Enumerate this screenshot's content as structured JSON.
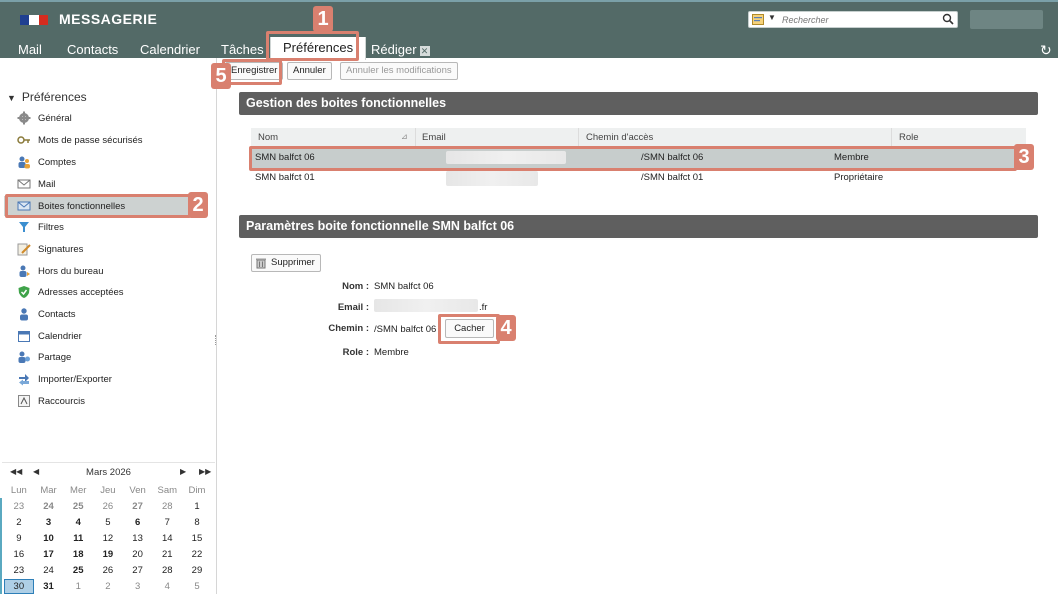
{
  "header": {
    "brand": "MESSAGERIE",
    "search_placeholder": "Rechercher",
    "flag_colors": [
      "#1f3f91",
      "#ffffff",
      "#d52b1e"
    ],
    "theme_color": "#536a67"
  },
  "tabs": [
    {
      "label": "Mail"
    },
    {
      "label": "Contacts"
    },
    {
      "label": "Calendrier"
    },
    {
      "label": "Tâches"
    },
    {
      "label": "Préférences",
      "active": true
    },
    {
      "label": "Rédiger",
      "closable": true
    }
  ],
  "toolbar": {
    "save": "Enregistrer",
    "cancel": "Annuler",
    "undo": "Annuler les modifications"
  },
  "sidebar": {
    "title": "Préférences",
    "items": [
      {
        "label": "Général",
        "icon": "gear-icon"
      },
      {
        "label": "Mots de passe sécurisés",
        "icon": "key-icon"
      },
      {
        "label": "Comptes",
        "icon": "users-icon"
      },
      {
        "label": "Mail",
        "icon": "envelope-icon"
      },
      {
        "label": "Boites fonctionnelles",
        "icon": "mailbox-icon",
        "selected": true
      },
      {
        "label": "Filtres",
        "icon": "filter-icon"
      },
      {
        "label": "Signatures",
        "icon": "pen-icon"
      },
      {
        "label": "Hors du bureau",
        "icon": "person-away-icon"
      },
      {
        "label": "Adresses acceptées",
        "icon": "shield-check-icon"
      },
      {
        "label": "Contacts",
        "icon": "contact-icon"
      },
      {
        "label": "Calendrier",
        "icon": "calendar-icon"
      },
      {
        "label": "Partage",
        "icon": "share-icon"
      },
      {
        "label": "Importer/Exporter",
        "icon": "import-export-icon"
      },
      {
        "label": "Raccourcis",
        "icon": "shortcut-icon"
      }
    ]
  },
  "calendar": {
    "title": "Mars 2026",
    "days": [
      "Lun",
      "Mar",
      "Mer",
      "Jeu",
      "Ven",
      "Sam",
      "Dim"
    ],
    "weeks": [
      [
        [
          "23",
          "o"
        ],
        [
          "24",
          "ob"
        ],
        [
          "25",
          "ob"
        ],
        [
          "26",
          "o"
        ],
        [
          "27",
          "ob"
        ],
        [
          "28",
          "o"
        ],
        [
          "1",
          ""
        ]
      ],
      [
        [
          "2",
          ""
        ],
        [
          "3",
          "b"
        ],
        [
          "4",
          "b"
        ],
        [
          "5",
          ""
        ],
        [
          "6",
          "b"
        ],
        [
          "7",
          ""
        ],
        [
          "8",
          ""
        ]
      ],
      [
        [
          "9",
          ""
        ],
        [
          "10",
          "b"
        ],
        [
          "11",
          "b"
        ],
        [
          "12",
          ""
        ],
        [
          "13",
          ""
        ],
        [
          "14",
          ""
        ],
        [
          "15",
          ""
        ]
      ],
      [
        [
          "16",
          ""
        ],
        [
          "17",
          "b"
        ],
        [
          "18",
          "b"
        ],
        [
          "19",
          "b"
        ],
        [
          "20",
          ""
        ],
        [
          "21",
          ""
        ],
        [
          "22",
          ""
        ]
      ],
      [
        [
          "23",
          ""
        ],
        [
          "24",
          ""
        ],
        [
          "25",
          "b"
        ],
        [
          "26",
          ""
        ],
        [
          "27",
          ""
        ],
        [
          "28",
          ""
        ],
        [
          "29",
          ""
        ]
      ],
      [
        [
          "30",
          "t"
        ],
        [
          "31",
          "b"
        ],
        [
          "1",
          "o"
        ],
        [
          "2",
          "o"
        ],
        [
          "3",
          "o"
        ],
        [
          "4",
          "o"
        ],
        [
          "5",
          "o"
        ]
      ]
    ]
  },
  "boxes_section": {
    "title": "Gestion des boites fonctionnelles",
    "columns": [
      "Nom",
      "Email",
      "Chemin d'accès",
      "Role"
    ],
    "rows": [
      {
        "name": "SMN balfct 06",
        "email": "",
        "path": "/SMN balfct 06",
        "role": "Membre",
        "selected": true
      },
      {
        "name": "SMN balfct 01",
        "email": "",
        "path": "/SMN balfct 01",
        "role": "Propriétaire",
        "selected": false
      }
    ]
  },
  "params_section": {
    "title": "Paramètres boite fonctionnelle SMN balfct 06",
    "delete_label": "Supprimer",
    "fields": [
      {
        "label": "Nom :",
        "value": "SMN balfct 06"
      },
      {
        "label": "Email :",
        "value": ".fr"
      },
      {
        "label": "Chemin :",
        "value": "/SMN balfct 06"
      },
      {
        "label": "Role :",
        "value": "Membre"
      }
    ],
    "hide_label": "Cacher"
  },
  "annotations": [
    "1",
    "2",
    "3",
    "4",
    "5"
  ],
  "annotation_color": "#d9806f"
}
